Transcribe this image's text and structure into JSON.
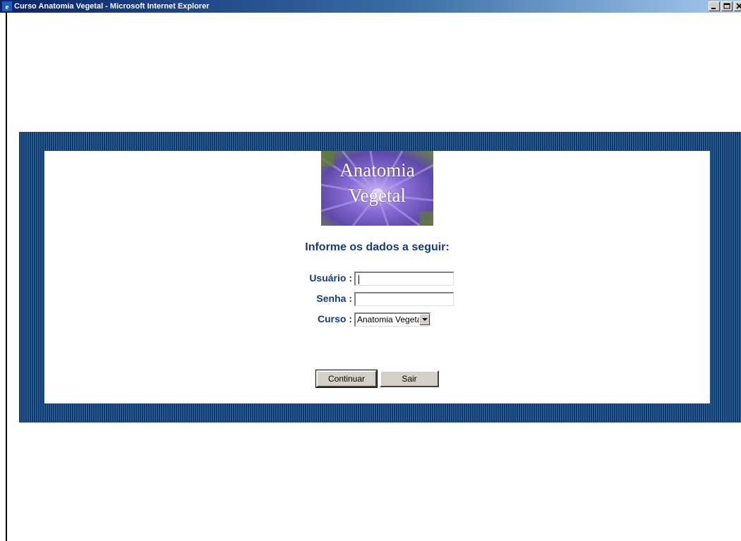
{
  "window": {
    "title": "Curso Anatomia Vegetal - Microsoft Internet Explorer"
  },
  "logo": {
    "line1": "Anatomia",
    "line2": "Vegetal"
  },
  "form": {
    "heading": "Informe os dados a seguir:",
    "usuario_label": "Usuário :",
    "usuario_value": "",
    "senha_label": "Senha :",
    "senha_value": "",
    "curso_label": "Curso :",
    "curso_selected": "Anatomia Vegetal"
  },
  "buttons": {
    "continue_label": "Continuar",
    "exit_label": "Sair"
  },
  "colors": {
    "band_dark": "#0d3a6e",
    "band_light": "#3d6a9a",
    "label_blue": "#123c86",
    "logo_purple": "#8a6bd6",
    "logo_green": "#6a8a3a"
  },
  "icons": {
    "browser": "ie-icon",
    "minimize": "minimize-icon",
    "maximize": "maximize-icon",
    "close": "close-icon",
    "dropdown": "chevron-down-icon"
  }
}
